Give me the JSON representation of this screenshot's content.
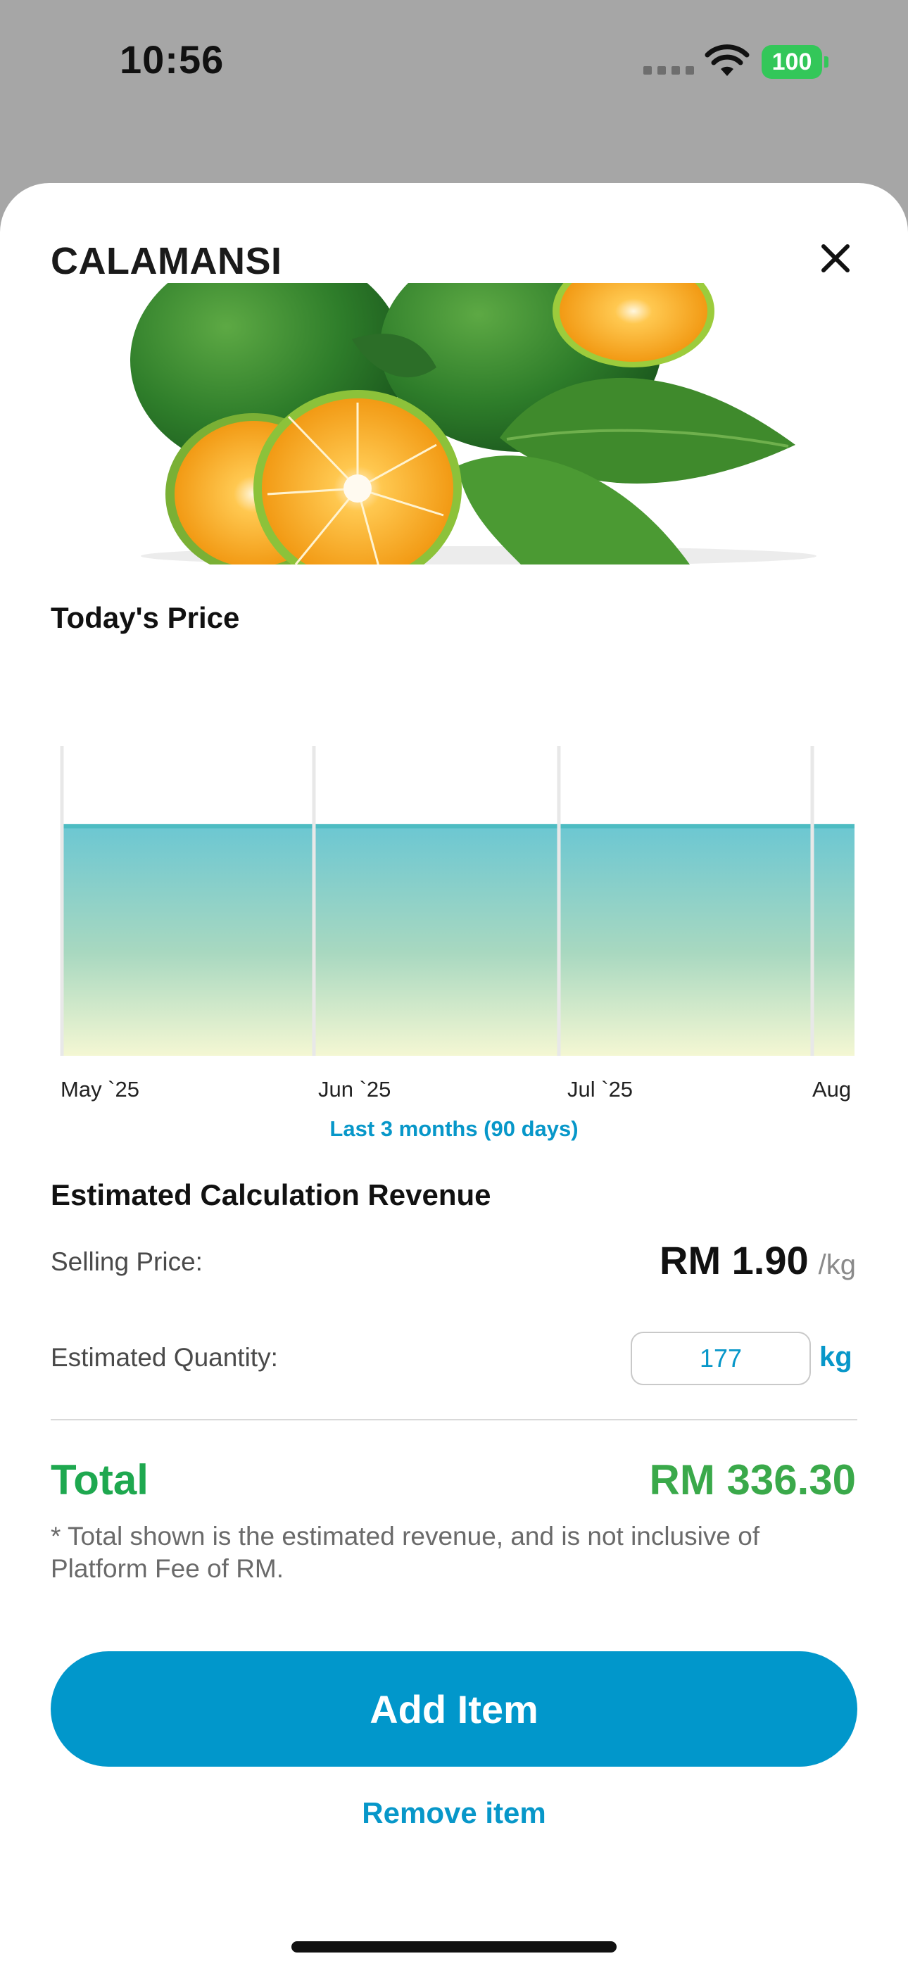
{
  "status_bar": {
    "time": "10:56",
    "battery_level": "100",
    "battery_color": "#33c759"
  },
  "sheet": {
    "title": "CALAMANSI",
    "close_icon": "close-icon",
    "hero_image": "calamansi-fruit-with-leaves"
  },
  "price_section": {
    "heading": "Today's Price",
    "range_label": "Last 3 months (90 days)"
  },
  "chart_data": {
    "type": "area",
    "x_tick_labels": [
      "May `25",
      "Jun `25",
      "Jul `25",
      "Aug"
    ],
    "series": [
      {
        "values": [
          1.9,
          1.9,
          1.9,
          1.9
        ]
      }
    ],
    "colors": {
      "line": "#4dbcc2",
      "fill_top": "#6cc7d2",
      "fill_bottom": "#f4f7d3"
    },
    "grid": "vertical lines at month ticks"
  },
  "calculation": {
    "heading": "Estimated Calculation Revenue",
    "selling_price_label": "Selling Price:",
    "selling_price_value": "RM 1.90",
    "selling_price_unit": "/kg",
    "quantity_label": "Estimated Quantity:",
    "quantity_value": "177",
    "quantity_unit": "kg"
  },
  "total": {
    "label": "Total",
    "value": "RM 336.30",
    "note": "* Total shown is the estimated revenue, and is not inclusive of Platform Fee of RM."
  },
  "actions": {
    "add_label": "Add Item",
    "remove_label": "Remove item",
    "accent_color": "#0197cb"
  }
}
